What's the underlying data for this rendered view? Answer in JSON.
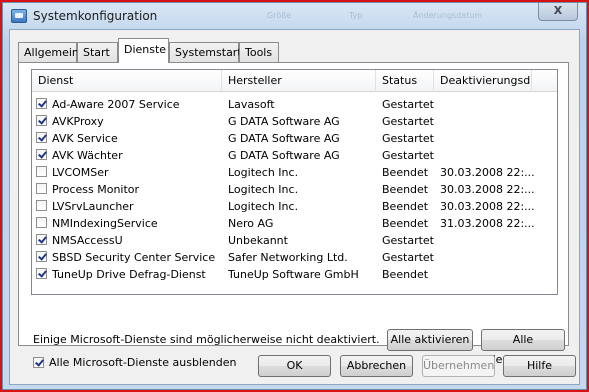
{
  "window": {
    "title": "Systemkonfiguration",
    "close_label": "X",
    "background_fragments": [
      "Größe",
      "Typ",
      "Änderungsdatum"
    ]
  },
  "tabs": [
    {
      "label": "Allgemein",
      "active": false
    },
    {
      "label": "Start",
      "active": false
    },
    {
      "label": "Dienste",
      "active": true
    },
    {
      "label": "Systemstart",
      "active": false
    },
    {
      "label": "Tools",
      "active": false
    }
  ],
  "table": {
    "columns": [
      "Dienst",
      "Hersteller",
      "Status",
      "Deaktivierungsd..."
    ],
    "rows": [
      {
        "checked": true,
        "service": "Ad-Aware 2007 Service",
        "vendor": "Lavasoft",
        "status": "Gestartet",
        "date": ""
      },
      {
        "checked": true,
        "service": "AVKProxy",
        "vendor": "G DATA Software AG",
        "status": "Gestartet",
        "date": ""
      },
      {
        "checked": true,
        "service": "AVK Service",
        "vendor": "G DATA Software AG",
        "status": "Gestartet",
        "date": ""
      },
      {
        "checked": true,
        "service": "AVK Wächter",
        "vendor": "G DATA Software AG",
        "status": "Gestartet",
        "date": ""
      },
      {
        "checked": false,
        "service": "LVCOMSer",
        "vendor": "Logitech Inc.",
        "status": "Beendet",
        "date": "30.03.2008 22:..."
      },
      {
        "checked": false,
        "service": "Process Monitor",
        "vendor": "Logitech Inc.",
        "status": "Beendet",
        "date": "30.03.2008 22:..."
      },
      {
        "checked": false,
        "service": "LVSrvLauncher",
        "vendor": "Logitech Inc.",
        "status": "Beendet",
        "date": "30.03.2008 22:..."
      },
      {
        "checked": false,
        "service": "NMIndexingService",
        "vendor": "Nero AG",
        "status": "Beendet",
        "date": "31.03.2008 22:..."
      },
      {
        "checked": true,
        "service": "NMSAccessU",
        "vendor": "Unbekannt",
        "status": "Gestartet",
        "date": ""
      },
      {
        "checked": true,
        "service": "SBSD Security Center Service",
        "vendor": "Safer Networking Ltd.",
        "status": "Gestartet",
        "date": ""
      },
      {
        "checked": true,
        "service": "TuneUp Drive Defrag-Dienst",
        "vendor": "TuneUp Software GmbH",
        "status": "Beendet",
        "date": ""
      }
    ]
  },
  "note": "Einige Microsoft-Dienste sind möglicherweise nicht deaktiviert.",
  "buttons": {
    "enable_all": "Alle aktivieren",
    "disable_all": "Alle deaktivieren",
    "ok": "OK",
    "cancel": "Abbrechen",
    "apply": "Übernehmen",
    "help": "Hilfe"
  },
  "hide_ms": {
    "checked": true,
    "label": "Alle Microsoft-Dienste ausblenden"
  }
}
